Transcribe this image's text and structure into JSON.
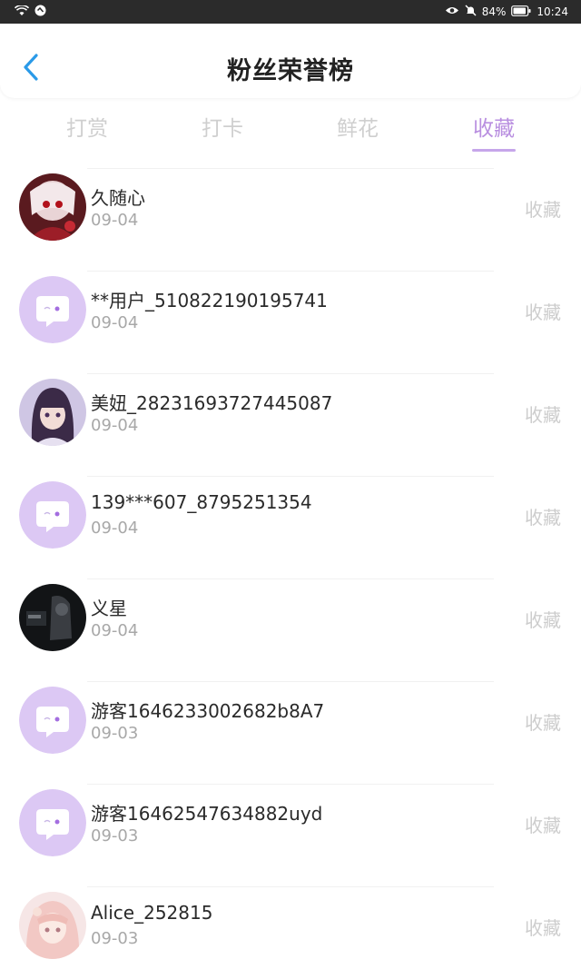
{
  "status_bar": {
    "battery": "84%",
    "time": "10:24"
  },
  "header": {
    "title": "粉丝荣誉榜"
  },
  "tabs": [
    {
      "label": "打赏",
      "active": false
    },
    {
      "label": "打卡",
      "active": false
    },
    {
      "label": "鲜花",
      "active": false
    },
    {
      "label": "收藏",
      "active": true
    }
  ],
  "colors": {
    "accent": "#b98fe0",
    "placeholder_avatar": "#dcc8f4"
  },
  "rows": [
    {
      "name": "久随心",
      "date": "09-04",
      "action": "收藏",
      "avatar": "photo-red-anime"
    },
    {
      "name": "**用户_510822190195741",
      "date": "09-04",
      "action": "收藏",
      "avatar": "default-chat-icon"
    },
    {
      "name": "美妞_28231693727445087",
      "date": "09-04",
      "action": "收藏",
      "avatar": "photo-anime-girl"
    },
    {
      "name": "139***607_8795251354",
      "date": "09-04",
      "action": "收藏",
      "avatar": "default-chat-icon"
    },
    {
      "name": "义星",
      "date": "09-04",
      "action": "收藏",
      "avatar": "photo-dark"
    },
    {
      "name": "游客1646233002682b8A7",
      "date": "09-03",
      "action": "收藏",
      "avatar": "default-chat-icon"
    },
    {
      "name": "游客16462547634882uyd",
      "date": "09-03",
      "action": "收藏",
      "avatar": "default-chat-icon"
    },
    {
      "name": "Alice_252815",
      "date": "09-03",
      "action": "收藏",
      "avatar": "photo-pink-anime"
    }
  ]
}
